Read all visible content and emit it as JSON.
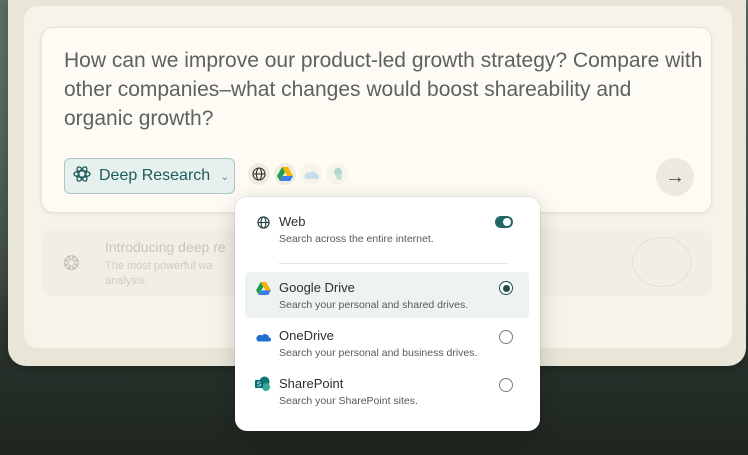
{
  "composer": {
    "prompt_text": "How can we improve our product-led growth strategy? Compare with other companies–what changes would boost shareability and organic growth?",
    "mode_label": "Deep Research"
  },
  "promo": {
    "title": "Introducing deep re",
    "description": "The most powerful wa analysis."
  },
  "sources_menu": {
    "options": [
      {
        "label": "Web",
        "description": "Search across the entire internet.",
        "control": "toggle",
        "enabled": true
      },
      {
        "label": "Google Drive",
        "description": "Search your personal and shared drives.",
        "control": "radio",
        "selected": true
      },
      {
        "label": "OneDrive",
        "description": "Search your personal and business drives.",
        "control": "radio",
        "selected": false
      },
      {
        "label": "SharePoint",
        "description": "Search your SharePoint sites.",
        "control": "radio",
        "selected": false
      }
    ]
  },
  "icons": {
    "mode": "atom-icon",
    "send": "arrow-right-icon",
    "web": "globe-icon",
    "google_drive": "google-drive-icon",
    "onedrive": "onedrive-cloud-icon",
    "sharepoint": "sharepoint-icon"
  },
  "colors": {
    "accent": "#1f6866",
    "mode_bg": "#e6f0ec",
    "selected_row": "#eef3f1"
  }
}
